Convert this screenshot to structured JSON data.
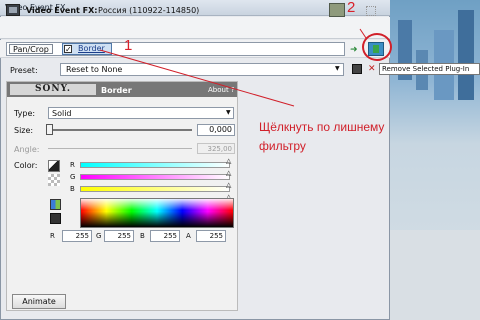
{
  "window": {
    "title": "Video Event FX"
  },
  "fx_bar": {
    "label": "Video Event FX:",
    "name": "Россия (110922-114850)"
  },
  "chain": {
    "items": [
      {
        "label": "Pan/Crop"
      },
      {
        "label": "Border",
        "checked": true
      }
    ]
  },
  "preset": {
    "label": "Preset:",
    "value": "Reset to None"
  },
  "plugin": {
    "brand": "SONY.",
    "title": "Border",
    "about": "About ?"
  },
  "fields": {
    "type": {
      "label": "Type:",
      "value": "Solid"
    },
    "size": {
      "label": "Size:",
      "value": "0,000"
    },
    "angle": {
      "label": "Angle:",
      "value": "325,00"
    },
    "color": {
      "label": "Color:"
    },
    "rgb_bars": [
      "R",
      "G",
      "B"
    ],
    "channels": [
      {
        "label": "R",
        "value": "255"
      },
      {
        "label": "G",
        "value": "255"
      },
      {
        "label": "B",
        "value": "255"
      },
      {
        "label": "A",
        "value": "255"
      }
    ]
  },
  "buttons": {
    "animate": "Animate"
  },
  "tooltip": "Remove Selected Plug-In",
  "annotations": {
    "step1": "1",
    "step2": "2",
    "hint": "Щёлкнуть по лишнему фильтру"
  },
  "colors": {
    "annotation": "#d1202a",
    "highlight": "#cfe0f3"
  }
}
